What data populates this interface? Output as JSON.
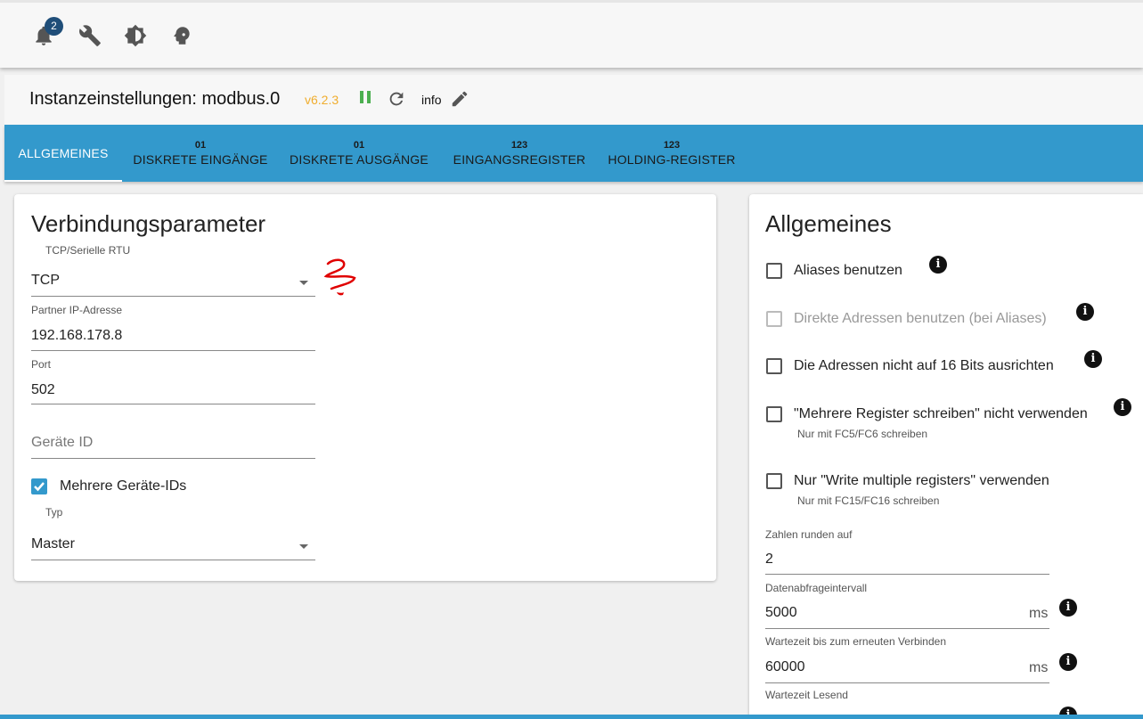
{
  "topbar": {
    "notification_count": "2",
    "icons": [
      "bell-icon",
      "wrench-icon",
      "brightness-icon",
      "head-icon"
    ]
  },
  "instance": {
    "title": "Instanzeinstellungen: modbus.0",
    "version": "v6.2.3",
    "info_label": "info"
  },
  "tabs": [
    {
      "label": "ALLGEMEINES",
      "icon": ""
    },
    {
      "label": "DISKRETE EINGÄNGE",
      "icon": "01"
    },
    {
      "label": "DISKRETE AUSGÄNGE",
      "icon": "01"
    },
    {
      "label": "EINGANGSREGISTER",
      "icon": "123"
    },
    {
      "label": "HOLDING-REGISTER",
      "icon": "123"
    }
  ],
  "connection": {
    "title": "Verbindungsparameter",
    "type_label": "TCP/Serielle RTU",
    "type_value": "TCP",
    "ip_label": "Partner IP-Adresse",
    "ip_value": "192.168.178.8",
    "port_label": "Port",
    "port_value": "502",
    "device_id_placeholder": "Geräte ID",
    "multi_ids_label": "Mehrere Geräte-IDs",
    "multi_ids_checked": true,
    "role_label": "Typ",
    "role_value": "Master"
  },
  "general": {
    "title": "Allgemeines",
    "checkboxes": [
      {
        "label": "Aliases benutzen",
        "help": "",
        "disabled": false
      },
      {
        "label": "Direkte Adressen benutzen (bei Aliases)",
        "help": "",
        "disabled": true
      },
      {
        "label": "Die Adressen nicht auf 16 Bits ausrichten",
        "help": "",
        "disabled": false
      },
      {
        "label": "\"Mehrere Register schreiben\" nicht verwenden",
        "help": "Nur mit FC5/FC6 schreiben",
        "disabled": false
      },
      {
        "label": "Nur \"Write multiple registers\" verwenden",
        "help": "Nur mit FC15/FC16 schreiben",
        "disabled": false
      }
    ],
    "round_label": "Zahlen runden auf",
    "round_value": "2",
    "poll_label": "Datenabfrageintervall",
    "poll_value": "5000",
    "poll_unit": "ms",
    "reconnect_label": "Wartezeit bis zum erneuten Verbinden",
    "reconnect_value": "60000",
    "reconnect_unit": "ms",
    "read_timeout_label": "Wartezeit Lesend"
  },
  "colors": {
    "accent": "#3399cc",
    "version": "#f0ad2e",
    "pause": "#4caf50",
    "badge": "#1f4e79",
    "annotation": "#e00000"
  }
}
